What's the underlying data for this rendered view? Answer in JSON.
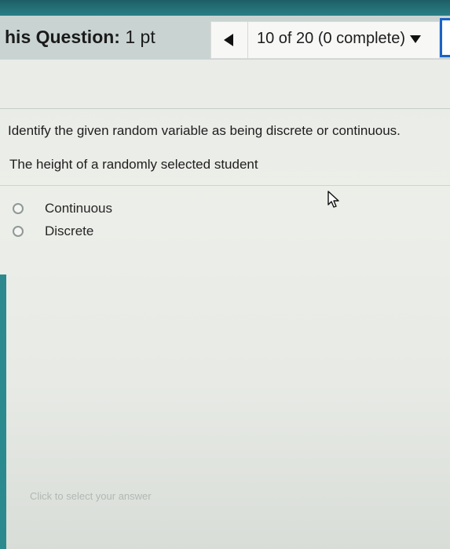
{
  "header": {
    "title_bold": "his Question:",
    "title_rest": " 1 pt",
    "progress_label": "10 of 20 (0 complete)"
  },
  "icons": {
    "prev": "left-triangle-icon",
    "dropdown": "caret-down-icon",
    "pointer": "mouse-pointer-icon"
  },
  "question": {
    "prompt": "Identify the given random variable as being discrete or continuous.",
    "statement": "The height of a randomly selected student",
    "options": [
      {
        "label": "Continuous",
        "selected": false
      },
      {
        "label": "Discrete",
        "selected": false
      }
    ]
  },
  "footer": {
    "hint": "Click to select your answer"
  },
  "colors": {
    "header_bg": "#c9d4d2",
    "page_bg": "#eceee9",
    "accent_blue": "#1b62c7",
    "teal_background": "#1f6b78"
  }
}
